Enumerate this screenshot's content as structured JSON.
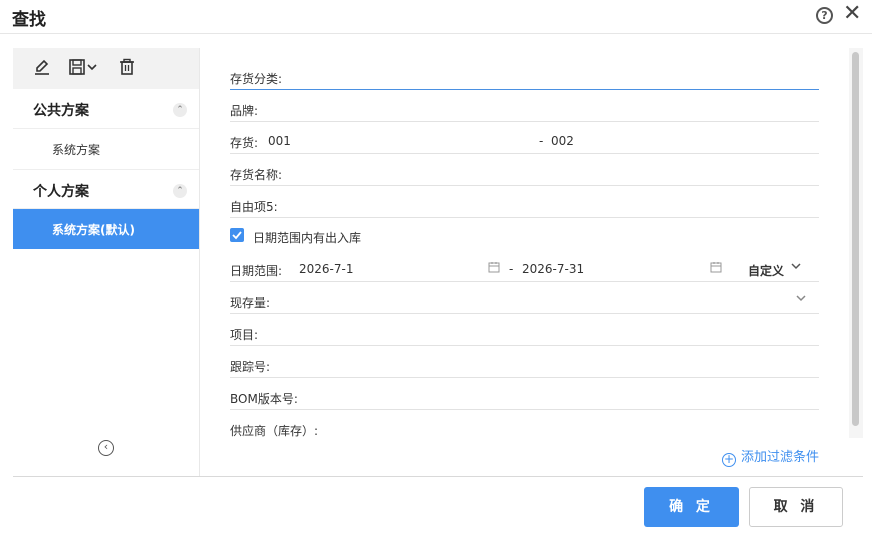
{
  "dialog": {
    "title": "查找"
  },
  "sidebar": {
    "toolbar_icons": [
      "edit-icon",
      "save-icon",
      "delete-icon"
    ],
    "sections": [
      {
        "title": "公共方案",
        "items": [
          "系统方案"
        ]
      },
      {
        "title": "个人方案",
        "items": [
          "系统方案(默认)"
        ]
      }
    ],
    "active_item": "系统方案(默认)"
  },
  "form": {
    "category": {
      "label": "存货分类:"
    },
    "brand": {
      "label": "品牌:"
    },
    "inventory": {
      "label": "存货:",
      "from": "001",
      "separator": "-",
      "to": "002"
    },
    "inventory_name": {
      "label": "存货名称:"
    },
    "free_item5": {
      "label": "自由项5:"
    },
    "date_checkbox": {
      "label": "日期范围内有出入库",
      "checked": true
    },
    "date_range": {
      "label": "日期范围:",
      "from": "2026-7-1",
      "separator": "-",
      "to": "2026-7-31",
      "mode": "自定义"
    },
    "stock_qty": {
      "label": "现存量:"
    },
    "project": {
      "label": "项目:"
    },
    "tracking_no": {
      "label": "跟踪号:"
    },
    "bom_version": {
      "label": "BOM版本号:"
    },
    "supplier": {
      "label": "供应商（库存）:"
    }
  },
  "actions": {
    "add_filter": "添加过滤条件",
    "ok": "确 定",
    "cancel": "取 消"
  },
  "colors": {
    "accent": "#3f8fef",
    "toolbar_bg": "#f2f2f2",
    "divider": "#e2e2e2"
  }
}
